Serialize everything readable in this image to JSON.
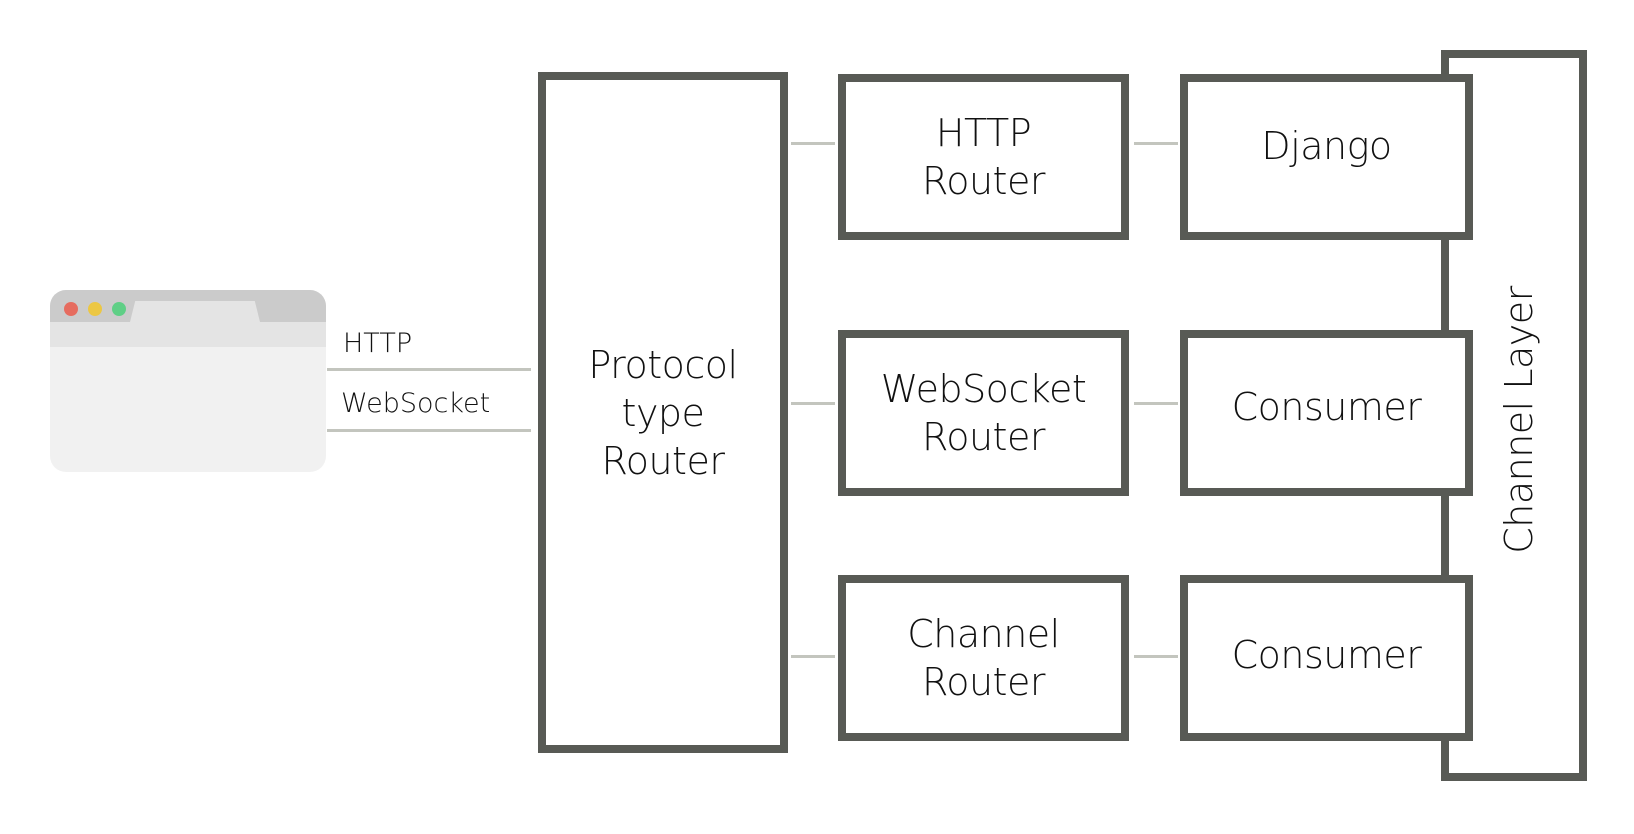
{
  "browser": {
    "window_dots": [
      {
        "name": "close",
        "color": "#e66c5f"
      },
      {
        "name": "minimize",
        "color": "#ecc743"
      },
      {
        "name": "maximize",
        "color": "#5fcf86"
      }
    ]
  },
  "protocols": [
    {
      "label": "HTTP"
    },
    {
      "label": "WebSocket"
    }
  ],
  "protocol_type_router": {
    "label": "Protocol\ntype\nRouter"
  },
  "routers": [
    {
      "label": "HTTP\nRouter"
    },
    {
      "label": "WebSocket\nRouter"
    },
    {
      "label": "Channel\nRouter"
    }
  ],
  "handlers": [
    {
      "label": "Django"
    },
    {
      "label": "Consumer"
    },
    {
      "label": "Consumer"
    }
  ],
  "channel_layer": {
    "label": "Channel Layer"
  },
  "colors": {
    "box_border": "#585a55",
    "connector": "#c3c5be"
  }
}
